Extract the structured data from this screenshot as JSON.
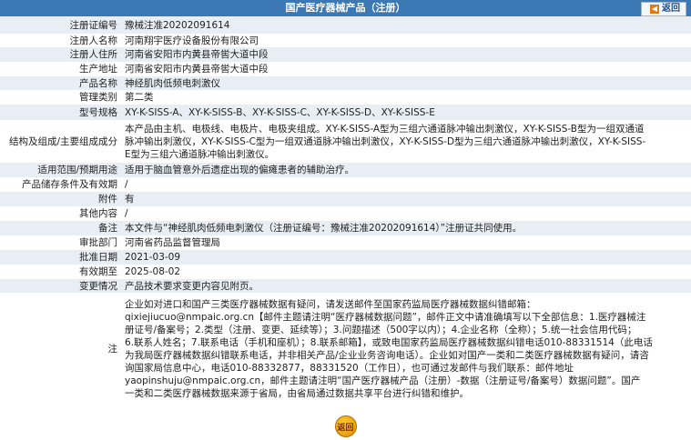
{
  "header": {
    "title": "国产医疗器械产品（注册）",
    "back_label": "返回"
  },
  "rows": {
    "reg_no": {
      "label": "注册证编号",
      "value": "豫械注准20202091614"
    },
    "registrant": {
      "label": "注册人名称",
      "value": "河南翔宇医疗设备股份有限公司"
    },
    "address": {
      "label": "注册人住所",
      "value": "河南省安阳市内黄县帝喾大道中段"
    },
    "production": {
      "label": "生产地址",
      "value": "河南省安阳市内黄县帝喾大道中段"
    },
    "product": {
      "label": "产品名称",
      "value": "神经肌肉低频电刺激仪"
    },
    "category": {
      "label": "管理类别",
      "value": "第二类"
    },
    "models": {
      "label": "型号规格",
      "value": "XY-K-SISS-A、XY-K-SISS-B、XY-K-SISS-C、XY-K-SISS-D、XY-K-SISS-E"
    },
    "structure": {
      "label": "结构及组成/主要组成成分",
      "lines": [
        "本产品由主机、电极线、电极片、电极夹组成。XY-K-SISS-A型为三组六通道脉冲输出刺激仪，XY-K-SISS-B型为一组双通道",
        "脉冲输出刺激仪，XY-K-SISS-C型为一组双通道脉冲输出刺激仪，XY-K-SISS-D型为三组六通道脉冲输出刺激仪，XY-K-SISS-",
        "E型为三组六通道脉冲输出刺激仪。"
      ]
    },
    "scope": {
      "label": "适用范围/预期用途",
      "value": "适用于脑血管意外后遗症出现的偏瘫患者的辅助治疗。"
    },
    "storage": {
      "label": "产品储存条件及有效期",
      "value": "/"
    },
    "attachment": {
      "label": "附件",
      "value": "有"
    },
    "other": {
      "label": "其他内容",
      "value": "/"
    },
    "remarks": {
      "label": "备注",
      "value": "本文件与“神经肌肉低频电刺激仪（注册证编号：豫械注准20202091614）”注册证共同使用。"
    },
    "dept": {
      "label": "审批部门",
      "value": "河南省药品监督管理局"
    },
    "approval": {
      "label": "批准日期",
      "value": "2021-03-09"
    },
    "expiry": {
      "label": "有效期至",
      "value": "2025-08-02"
    },
    "changes": {
      "label": "变更情况",
      "value": "产品技术要求变更内容见附页。"
    },
    "note": {
      "label": "注",
      "lines": [
        "企业如对进口和国产三类医疗器械数据有疑问，请发送邮件至国家药监局医疗器械数据纠错邮箱：",
        "qixiejiucuo@nmpaic.org.cn【邮件主题请注明“医疗器械数据问题”，邮件正文中请准确填写以下全部信息：1.医疗器械注",
        "册证号/备案号；2.类型（注册、变更、延续等）；3.问题描述（500字以内）；4.企业名称（全称）；5.统一社会信用代码；",
        "6.联系人姓名；7.联系电话（手机和座机）；8.联系邮箱】，或致电国家药监局医疗器械数据纠错电话010-88331514（此电话",
        "为我局医疗器械数据纠错联系电话，并非相关产品/企业业务咨询电话）。企业如对国产一类和二类医疗器械数据有疑问，请咨",
        "询国家局信息中心，电话010-88332877，88331520（工作日），也可通过发邮件与我们联系：邮件地址",
        "yaopinshuju@nmpaic.org.cn，邮件主题请注明“国产医疗器械产品（注册）-数据（注册证号/备案号）数据问题”。国产",
        "一类和二类医疗器械数据来源于省局，由省局通过数据共享平台进行纠错和维护。"
      ]
    }
  },
  "footer": {
    "back_label": "返回"
  }
}
